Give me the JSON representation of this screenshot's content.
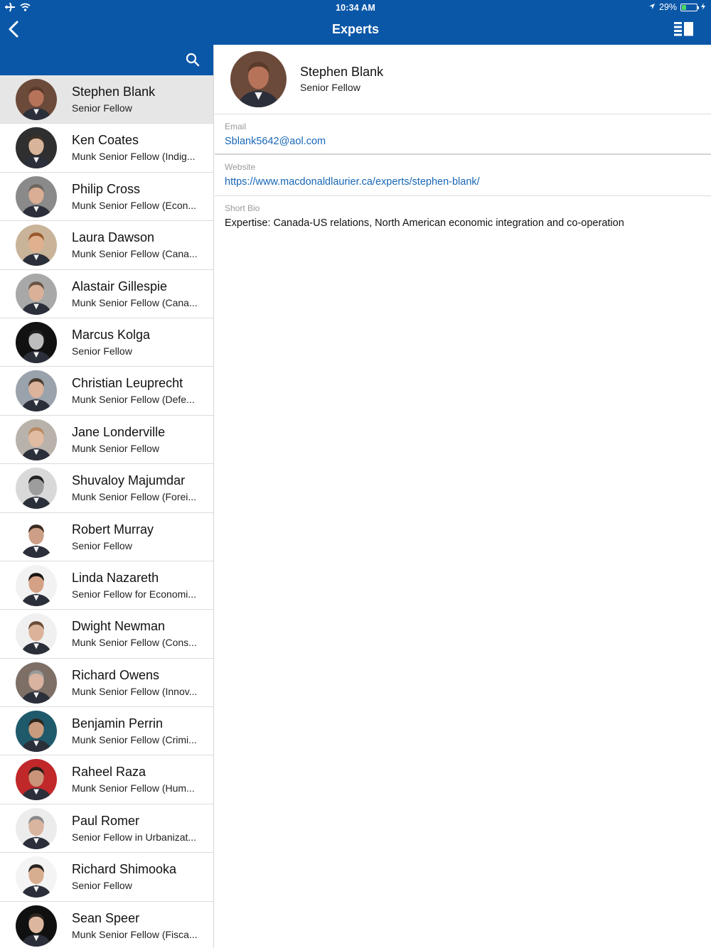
{
  "status_bar": {
    "time": "10:34 AM",
    "battery": "29%",
    "battery_level": 0.29,
    "icons": [
      "airplane-icon",
      "wifi-icon",
      "location-icon",
      "battery-icon",
      "charging-icon"
    ]
  },
  "nav": {
    "title": "Experts",
    "back_icon": "chevron-left-icon",
    "panel_icon": "split-view-icon"
  },
  "search": {
    "icon": "search-icon"
  },
  "colors": {
    "brand": "#0a57a8",
    "link": "#1766b5",
    "selected_row": "#e6e6e6"
  },
  "experts": [
    {
      "name": "Stephen Blank",
      "title": "Senior Fellow",
      "selected": true,
      "skin": "#b7735a",
      "hair": "#5a3a2a",
      "bg": "#6b4a3a"
    },
    {
      "name": "Ken Coates",
      "title": "Munk Senior Fellow (Indig...",
      "skin": "#d8b59a",
      "hair": "#3c3026",
      "bg": "#2f2f2f"
    },
    {
      "name": "Philip Cross",
      "title": "Munk Senior Fellow (Econ...",
      "skin": "#d9ae95",
      "hair": "#6e655e",
      "bg": "#8a8a8a"
    },
    {
      "name": "Laura Dawson",
      "title": "Munk Senior Fellow (Cana...",
      "skin": "#e0b08f",
      "hair": "#9a5a2c",
      "bg": "#c9b49a"
    },
    {
      "name": "Alastair Gillespie",
      "title": "Munk Senior Fellow (Cana...",
      "skin": "#d9b198",
      "hair": "#6a5444",
      "bg": "#a8a8a8"
    },
    {
      "name": "Marcus Kolga",
      "title": "Senior Fellow",
      "skin": "#bdbdbd",
      "hair": "#1e1e1e",
      "bg": "#111111"
    },
    {
      "name": "Christian Leuprecht",
      "title": "Munk Senior Fellow (Defe...",
      "skin": "#dcb39b",
      "hair": "#4a3a2e",
      "bg": "#9aa2ab"
    },
    {
      "name": "Jane Londerville",
      "title": "Munk Senior Fellow",
      "skin": "#e2bba3",
      "hair": "#b88a60",
      "bg": "#b9b2aa"
    },
    {
      "name": "Shuvaloy Majumdar",
      "title": "Munk Senior Fellow (Forei...",
      "skin": "#9d9d9d",
      "hair": "#222222",
      "bg": "#d9d9d9"
    },
    {
      "name": "Robert Murray",
      "title": "Senior Fellow",
      "skin": "#cc9f86",
      "hair": "#3b2b22",
      "bg": "#ffffff"
    },
    {
      "name": "Linda Nazareth",
      "title": "Senior Fellow for Economi...",
      "skin": "#d5a184",
      "hair": "#1c1614",
      "bg": "#f2f2f2"
    },
    {
      "name": "Dwight Newman",
      "title": "Munk Senior Fellow (Cons...",
      "skin": "#dbb39a",
      "hair": "#6b4d38",
      "bg": "#f0f0f0"
    },
    {
      "name": "Richard Owens",
      "title": "Munk Senior Fellow (Innov...",
      "skin": "#d9b3a0",
      "hair": "#9a9a9a",
      "bg": "#7d6f66"
    },
    {
      "name": "Benjamin Perrin",
      "title": "Munk Senior Fellow (Crimi...",
      "skin": "#c89b7e",
      "hair": "#2e241e",
      "bg": "#1f5a6b"
    },
    {
      "name": "Raheel Raza",
      "title": "Munk Senior Fellow (Hum...",
      "skin": "#c99478",
      "hair": "#2a1e18",
      "bg": "#c0282a"
    },
    {
      "name": "Paul Romer",
      "title": "Senior Fellow in Urbanizat...",
      "skin": "#d9b49f",
      "hair": "#8a8a8a",
      "bg": "#ececec"
    },
    {
      "name": "Richard Shimooka",
      "title": "Senior Fellow",
      "skin": "#d8ae90",
      "hair": "#2a2320",
      "bg": "#f4f4f4"
    },
    {
      "name": "Sean Speer",
      "title": "Munk Senior Fellow (Fisca...",
      "skin": "#dcb69e",
      "hair": "#2e2620",
      "bg": "#101010"
    }
  ],
  "detail": {
    "name": "Stephen Blank",
    "title": "Senior Fellow",
    "email_label": "Email",
    "email": "Sblank5642@aol.com",
    "website_label": "Website",
    "website": "https://www.macdonaldlaurier.ca/experts/stephen-blank/",
    "bio_label": "Short Bio",
    "bio": "Expertise: Canada-US relations, North American economic integration and co-operation"
  }
}
